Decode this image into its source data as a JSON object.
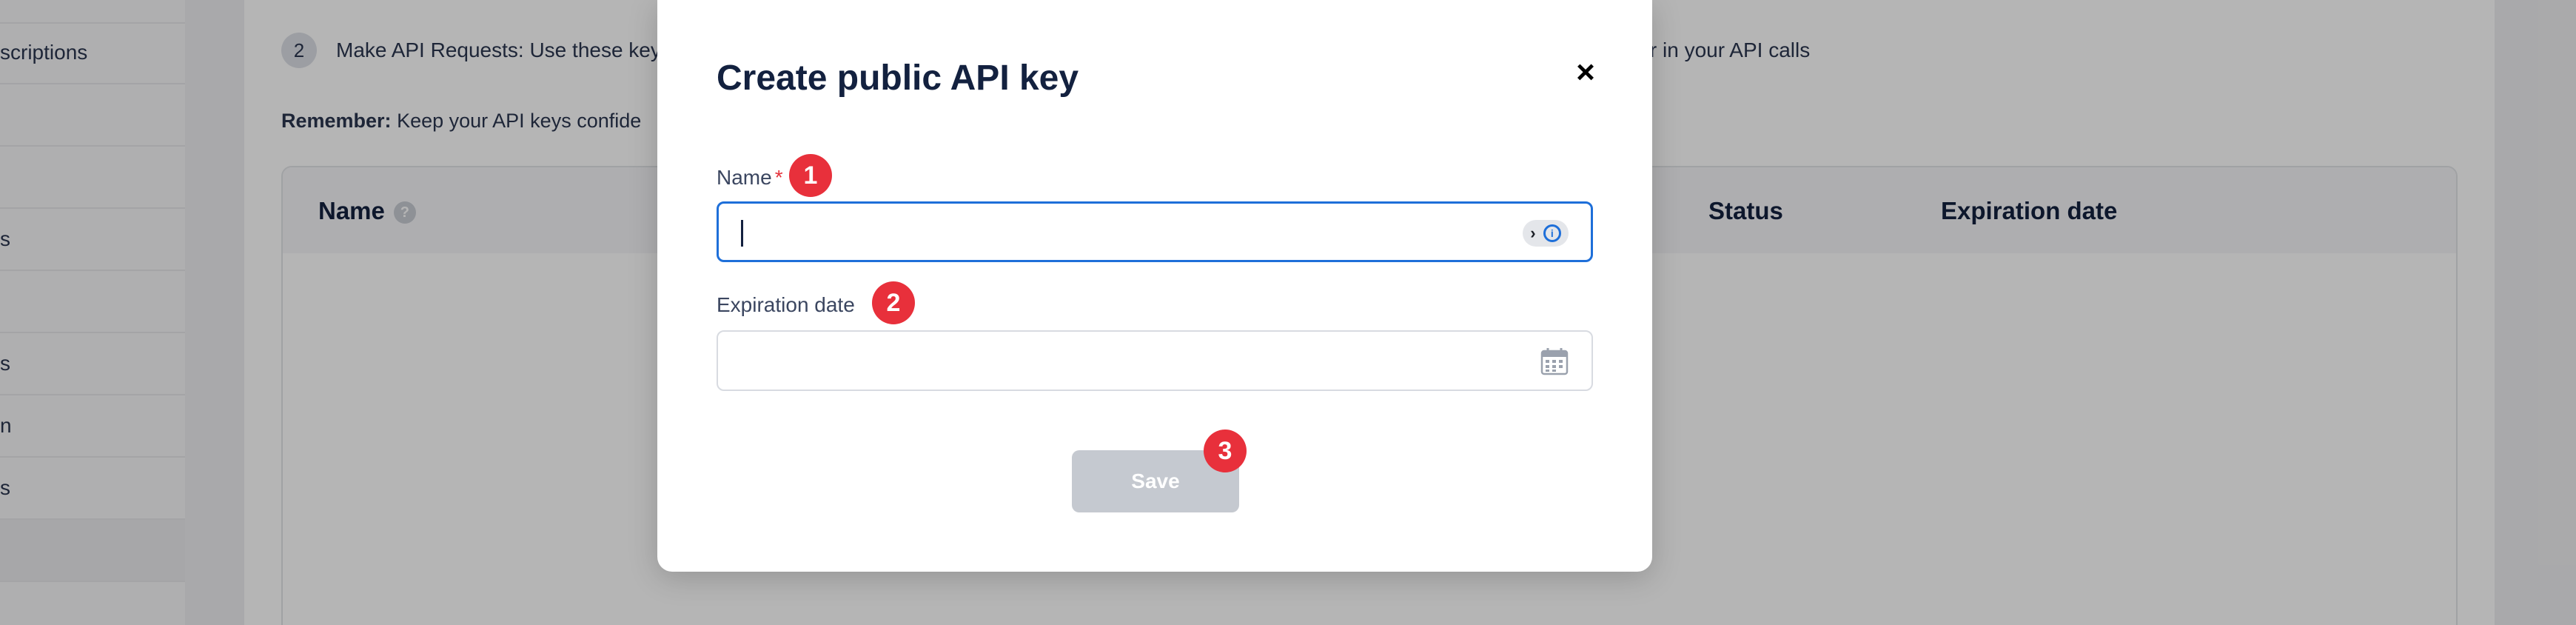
{
  "sidebar": {
    "items": [
      {
        "label": ""
      },
      {
        "label": "scriptions"
      },
      {
        "label": ""
      },
      {
        "label": ""
      },
      {
        "label": "s"
      },
      {
        "label": ""
      },
      {
        "label": "s"
      },
      {
        "label": "n"
      },
      {
        "label": "s"
      },
      {
        "label": ""
      }
    ]
  },
  "content": {
    "step_number": "2",
    "step_text": "Make API Requests: Use these key",
    "step_text_tail": "eter in your API calls",
    "remember_label": "Remember:",
    "remember_text": " Keep your API keys confide",
    "table_headers": {
      "name": "Name",
      "name_help": "?",
      "status": "Status",
      "expiration_date": "Expiration date"
    }
  },
  "modal": {
    "title": "Create public API key",
    "close_glyph": "×",
    "name_label": "Name",
    "name_required_mark": "*",
    "name_value": "",
    "name_badge": "1",
    "expiration_label": "Expiration date",
    "expiration_value": "",
    "expiration_badge": "2",
    "save_label": "Save",
    "save_badge": "3",
    "icons": {
      "password_manager": "password-manager-icon",
      "calendar": "calendar-icon",
      "close": "close-icon"
    }
  }
}
